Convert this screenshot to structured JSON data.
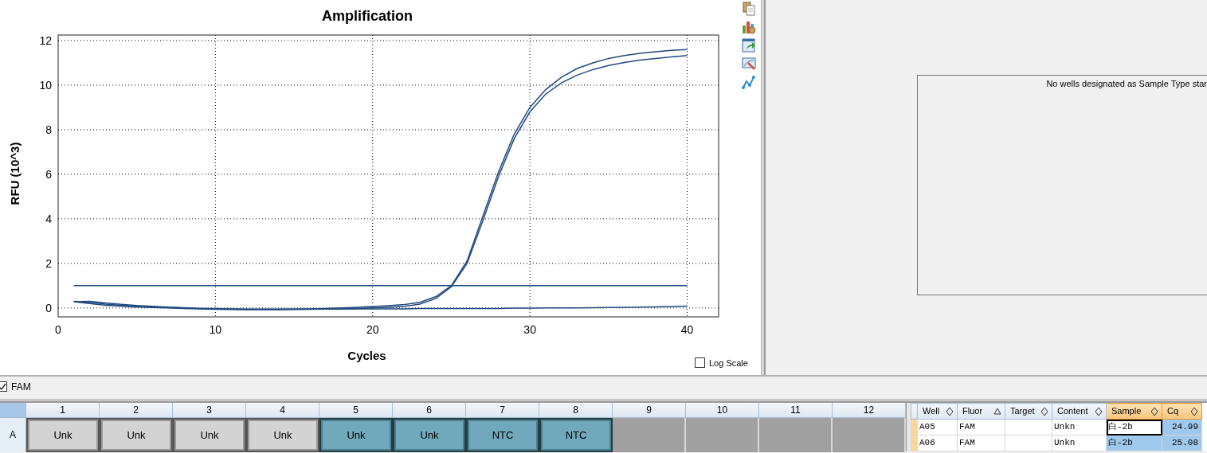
{
  "chart": {
    "title": "Amplification",
    "chart_data": {
      "type": "line",
      "xlabel": "Cycles",
      "ylabel": "RFU (10^3)",
      "x": [
        1,
        2,
        3,
        4,
        5,
        6,
        7,
        8,
        9,
        10,
        11,
        12,
        13,
        14,
        15,
        16,
        17,
        18,
        19,
        20,
        21,
        22,
        23,
        24,
        25,
        26,
        27,
        28,
        29,
        30,
        31,
        32,
        33,
        34,
        35,
        36,
        37,
        38,
        39,
        40
      ],
      "xlim": [
        0,
        42
      ],
      "ylim": [
        -0.4,
        12.25
      ],
      "grid": true,
      "xticks": [
        0,
        10,
        20,
        30,
        40
      ],
      "yticks": [
        0,
        2,
        4,
        6,
        8,
        10,
        12
      ],
      "series": [
        {
          "color": "#1f4a80",
          "values": [
            0.28,
            0.3,
            0.22,
            0.16,
            0.11,
            0.07,
            0.04,
            0.01,
            -0.02,
            -0.04,
            -0.05,
            -0.06,
            -0.06,
            -0.06,
            -0.05,
            -0.04,
            -0.02,
            0,
            0.03,
            0.06,
            0.1,
            0.15,
            0.25,
            0.5,
            1.0,
            2.1,
            4.1,
            6.1,
            7.8,
            9.0,
            9.8,
            10.35,
            10.75,
            11.0,
            11.2,
            11.33,
            11.43,
            11.5,
            11.56,
            11.6
          ]
        },
        {
          "color": "#1f4a80",
          "values": [
            0.28,
            0.2,
            0.12,
            0.08,
            0.04,
            0.02,
            0,
            -0.02,
            -0.04,
            -0.06,
            -0.07,
            -0.08,
            -0.08,
            -0.08,
            -0.07,
            -0.06,
            -0.05,
            -0.04,
            -0.02,
            0,
            0.03,
            0.07,
            0.17,
            0.42,
            0.95,
            2.0,
            3.9,
            5.9,
            7.6,
            8.8,
            9.6,
            10.1,
            10.45,
            10.7,
            10.88,
            11.02,
            11.12,
            11.2,
            11.27,
            11.33
          ]
        },
        {
          "color": "#1f4a80",
          "values": [
            0.3,
            0.25,
            0.17,
            0.12,
            0.08,
            0.05,
            0.02,
            0,
            -0.02,
            -0.03,
            -0.04,
            -0.05,
            -0.05,
            -0.05,
            -0.05,
            -0.05,
            -0.05,
            -0.05,
            -0.04,
            -0.04,
            -0.04,
            -0.04,
            -0.03,
            -0.03,
            -0.02,
            -0.02,
            -0.02,
            -0.02,
            -0.01,
            -0.01,
            0,
            0,
            0,
            0.01,
            0.02,
            0.03,
            0.04,
            0.05,
            0.06,
            0.08
          ]
        },
        {
          "color": "#1f4a80",
          "values": [
            1,
            1,
            1,
            1,
            1,
            1,
            1,
            1,
            1,
            1,
            1,
            1,
            1,
            1,
            1,
            1,
            1,
            1,
            1,
            1,
            1,
            1,
            1,
            1,
            1,
            1,
            1,
            1,
            1,
            1,
            1,
            1,
            1,
            1,
            1,
            1,
            1,
            1,
            1,
            1
          ]
        }
      ]
    }
  },
  "log_scale": {
    "label": "Log Scale",
    "checked": false
  },
  "toolbar": [
    {
      "kind": "copy"
    },
    {
      "kind": "settings"
    },
    {
      "kind": "export"
    },
    {
      "kind": "edit"
    },
    {
      "kind": "curve"
    }
  ],
  "standard_curve_panel": {
    "message": "No wells designated as Sample Type star"
  },
  "fluor_filters": [
    {
      "label": "FAM",
      "checked": true
    }
  ],
  "plate": {
    "columns": [
      "1",
      "2",
      "3",
      "4",
      "5",
      "6",
      "7",
      "8",
      "9",
      "10",
      "11",
      "12"
    ],
    "rows": [
      {
        "label": "A",
        "wells": [
          {
            "kind": "sample",
            "label": "Unk",
            "selected": false
          },
          {
            "kind": "sample",
            "label": "Unk",
            "selected": false
          },
          {
            "kind": "sample",
            "label": "Unk",
            "selected": false
          },
          {
            "kind": "sample",
            "label": "Unk",
            "selected": false
          },
          {
            "kind": "sample",
            "label": "Unk",
            "selected": true
          },
          {
            "kind": "sample",
            "label": "Unk",
            "selected": true
          },
          {
            "kind": "sample",
            "label": "NTC",
            "selected": true
          },
          {
            "kind": "sample",
            "label": "NTC",
            "selected": true
          },
          {
            "kind": "empty"
          },
          {
            "kind": "empty"
          },
          {
            "kind": "empty"
          },
          {
            "kind": "empty"
          }
        ]
      }
    ]
  },
  "results_table": {
    "columns": [
      {
        "label": "Well",
        "sorted": false,
        "selected": false
      },
      {
        "label": "Fluor",
        "sorted": true,
        "selected": false
      },
      {
        "label": "Target",
        "sorted": false,
        "selected": false
      },
      {
        "label": "Content",
        "sorted": false,
        "selected": false
      },
      {
        "label": "Sample",
        "sorted": false,
        "selected": true
      },
      {
        "label": "Cq",
        "sorted": false,
        "selected": true
      }
    ],
    "rows": [
      {
        "cells": [
          "A05",
          "FAM",
          null,
          "Unkn",
          "白-2b",
          "24.99"
        ],
        "focused": true
      },
      {
        "cells": [
          "A06",
          "FAM",
          null,
          "Unkn",
          "白-2b",
          "25.08"
        ],
        "focused": false
      }
    ]
  }
}
